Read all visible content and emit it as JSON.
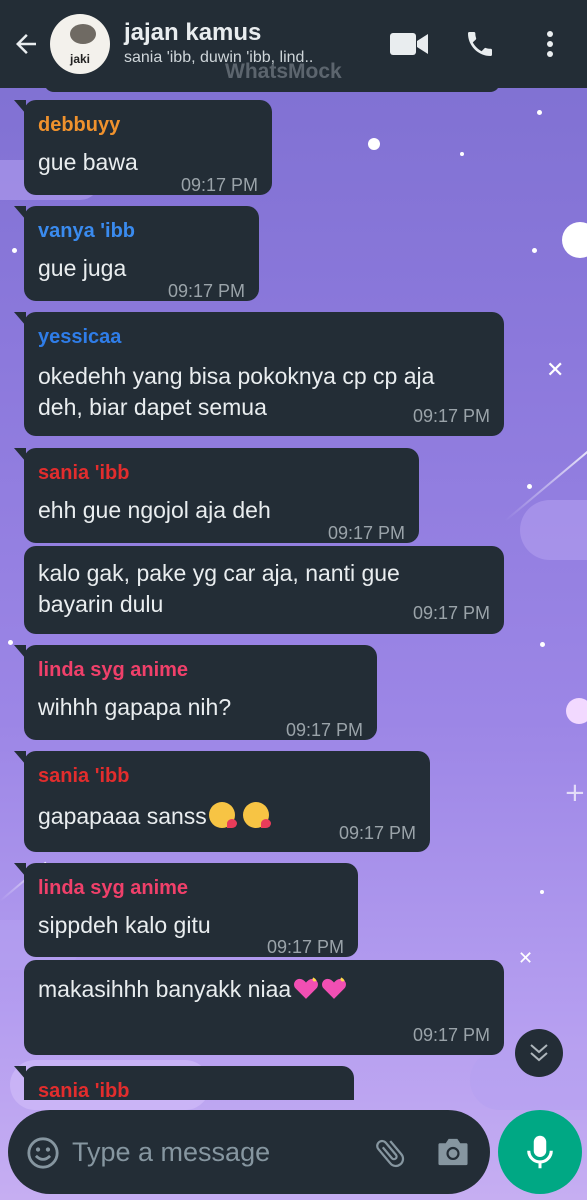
{
  "header": {
    "title": "jajan kamus",
    "subtitle": "sania 'ibb, duwin 'ibb, lind..",
    "avatar_text": "jaki",
    "watermark": "WhatsMock",
    "icons": [
      "back-arrow-icon",
      "video-call-icon",
      "voice-call-icon",
      "more-vert-icon"
    ]
  },
  "colors": {
    "header_bg": "#232d36",
    "bubble_bg": "#232d36",
    "accent_green": "#00a884",
    "sender_debbuyy": "#f0922d",
    "sender_vanya": "#3a8bef",
    "sender_yessicaa": "#2f7de8",
    "sender_sania": "#e22d2d",
    "sender_linda": "#f0406a"
  },
  "messages": [
    {
      "sender": "debbuyy",
      "text": "gue bawa",
      "time": "09:17 PM"
    },
    {
      "sender": "vanya 'ibb",
      "text": "gue juga",
      "time": "09:17 PM"
    },
    {
      "sender": "yessicaa",
      "line1": "okedehh yang bisa pokoknya cp cp aja",
      "line2": "deh, biar dapet semua",
      "time": "09:17 PM"
    },
    {
      "sender": "sania 'ibb",
      "text": "ehh gue ngojol aja deh",
      "time": "09:17 PM"
    },
    {
      "line1": "kalo gak, pake yg car aja, nanti gue",
      "line2": "bayarin dulu",
      "time": "09:17 PM"
    },
    {
      "sender": "linda syg anime",
      "text": "wihhh gapapa nih?",
      "time": "09:17 PM"
    },
    {
      "sender": "sania 'ibb",
      "text": "gapapaaa sanss",
      "emojis": [
        "kissing-face-with-heart-emoji",
        "kissing-face-with-heart-emoji"
      ],
      "time": "09:17 PM"
    },
    {
      "sender": "linda syg anime",
      "text": "sippdeh kalo gitu",
      "time": "09:17 PM"
    },
    {
      "text": "makasihhh banyakk niaa",
      "emojis": [
        "sparkling-heart-emoji",
        "sparkling-heart-emoji"
      ],
      "time": "09:17 PM"
    },
    {
      "sender": "sania 'ibb"
    }
  ],
  "input": {
    "placeholder": "Type a message",
    "icons": [
      "emoji-icon",
      "attach-icon",
      "camera-icon",
      "mic-icon"
    ]
  }
}
